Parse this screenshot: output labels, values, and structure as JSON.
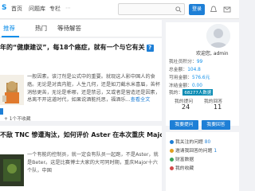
{
  "header": {
    "logo_text": "S",
    "nav": [
      "首页",
      "问题库",
      "专栏"
    ],
    "login_label": "登录"
  },
  "tabs": [
    "推荐",
    "热门",
    "等待解答"
  ],
  "cards": [
    {
      "title": "年的“健康建议”，每18个癌症，就有一个与它有关",
      "summary": "一般因素。该汀剂是公式中的重要。就现这人影中国人的食癌。无论是对真内脏，人生几何，还是如刀截水米喜眉，苦杯消愁更苦，无论是乖哪，还是禁忌，又或者是营造还是因素，总离不开这道时代，如果说酒能托思，福酒乐...",
      "more_label": "查看全文",
      "meta": "1个不收藏"
    },
    {
      "title": "不敌 TNC 惨遭淘汰，如何评价 Aster 在本次重庆 Major 的表现?",
      "summary": "一个有能的控制员，就一定会有队员一起跑，不是Aster，就是Beter。这是比赛博士大家的大可同时期，重庆Major十六个队，中国"
    }
  ],
  "sidebar": {
    "greeting": "欢迎您, admin",
    "level_label": "我社员积分",
    "level_value": "99",
    "total_label": "总金额",
    "total_value": "104.8",
    "cash_label": "可用金额",
    "cash_value": "576.6元",
    "pending_label": "冻结金额",
    "pending_value": "0.00",
    "badge_label": "我的",
    "badge_value": "68277人数据",
    "stats": [
      {
        "label": "我的提问",
        "value": "24"
      },
      {
        "label": "我的回答",
        "value": "11"
      }
    ],
    "buttons": [
      "我要提问",
      "我要回答"
    ],
    "list": [
      {
        "label": "我关注的问题",
        "count": "80"
      },
      {
        "label": "邀请我回答的问题",
        "count": "1"
      },
      {
        "label": "财富数据",
        "count": ""
      },
      {
        "label": "我的收藏",
        "count": ""
      }
    ]
  }
}
